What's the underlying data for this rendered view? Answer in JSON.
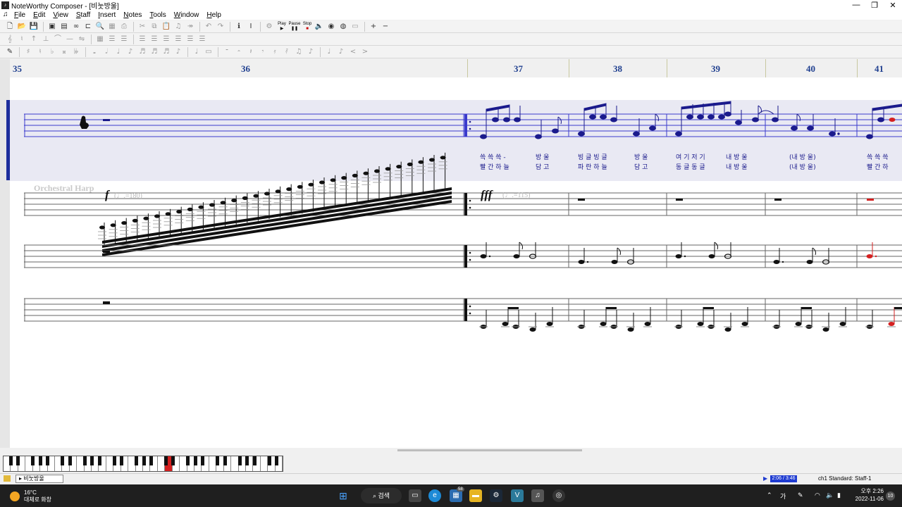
{
  "window": {
    "title": "NoteWorthy Composer - [비눗방울]",
    "controls": [
      "—",
      "❐",
      "✕"
    ]
  },
  "menu": [
    "File",
    "Edit",
    "View",
    "Staff",
    "Insert",
    "Notes",
    "Tools",
    "Window",
    "Help"
  ],
  "toolbar": {
    "row1": [
      "new-icon",
      "open-icon",
      "save-icon",
      "|",
      "close-icon",
      "preview-icon",
      "insert-bar-icon",
      "zoom-icon",
      "print-icon",
      "|",
      "cut-icon",
      "copy-icon",
      "paste-icon",
      "note-icon",
      "duplicate-icon",
      "|",
      "undo-icon",
      "redo-icon",
      "|",
      "info-icon",
      "text-icon",
      "|",
      "record-icon"
    ],
    "play_label": "Play",
    "pause_label": "Pause",
    "stop_label": "Stop",
    "zoom_in": "+",
    "zoom_out": "−"
  },
  "measures": [
    "35",
    "36",
    "37",
    "38",
    "39",
    "40",
    "41"
  ],
  "staff": {
    "instrument_label": "Orchestral Harp",
    "dynamic_1": "f",
    "dynamic_1_tempo": "(♩.=180)",
    "dynamic_2": "fff",
    "dynamic_2_tempo": "(♩.=115)"
  },
  "lyrics": {
    "line1": [
      "쓱 쓱 쓱 -",
      "방  울",
      "빙 글 빙 글",
      "방  울",
      "여 기 저 기",
      "내 방 울",
      "(내  방   울)",
      "쓱 쓱 쓱"
    ],
    "line2": [
      "빨 간 하 늘",
      "담  고",
      "파 란 하 늘",
      "담  고",
      "동 글 동 글",
      "내 방 울",
      "(내  방   울)",
      "빨 간 하"
    ]
  },
  "status": {
    "tab": "비눗방울",
    "time": "2:06 / 3:46",
    "staff_info": "ch1 Standard: Staff-1"
  },
  "taskbar": {
    "temperature": "16°C",
    "weather_text": "대체로 화창",
    "search_label": "검색",
    "tray_lang": "가",
    "clock_time": "오후 2:26",
    "clock_date": "2022-11-06",
    "notification_count": "10",
    "badge": "58"
  },
  "colors": {
    "measure_number": "#1f3f8f",
    "active_staff": "#1d2e9c",
    "note_blue": "#1a1a8c",
    "note_red": "#d42020",
    "time_highlight": "#1e3bd1"
  }
}
